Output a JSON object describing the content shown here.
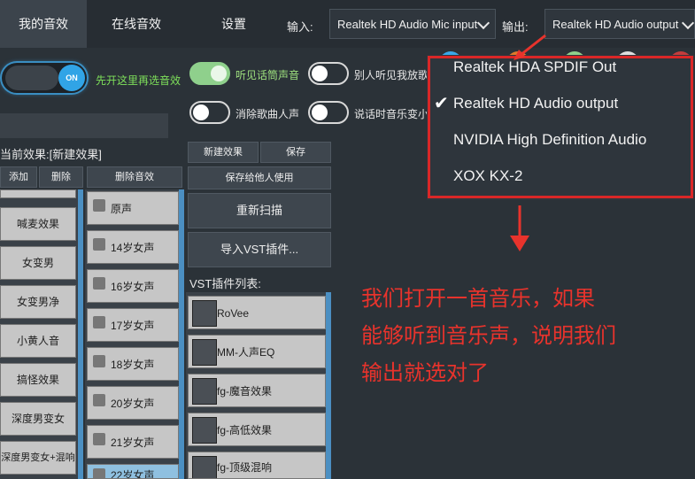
{
  "tabs": [
    "我的音效",
    "在线音效",
    "设置"
  ],
  "input_label": "输入:",
  "input_value": "Realtek HD Audio Mic input",
  "output_label": "输出:",
  "output_value": "Realtek HD Audio output",
  "main_switch_label": "ON",
  "main_switch_hint": "先开这里再选音效",
  "toggles": [
    "听见话筒声音",
    "别人听见我放歌",
    "消除歌曲人声",
    "说话时音乐变小"
  ],
  "current_effect": "当前效果:[新建效果]",
  "left_buttons": [
    "添加",
    "删除",
    "删除音效"
  ],
  "right_buttons": [
    "新建效果",
    "保存",
    "保存给他人使用",
    "重新扫描",
    "导入VST插件..."
  ],
  "effects_list": [
    "喊麦效果",
    "女变男",
    "女变男净",
    "小黄人音",
    "搞怪效果",
    "深度男变女",
    "深度男变女+混响"
  ],
  "voice_list": [
    "原声",
    "14岁女声",
    "16岁女声",
    "17岁女声",
    "18岁女声",
    "20岁女声",
    "21岁女声",
    "22岁女声"
  ],
  "vst_header": "VST插件列表:",
  "vst_list": [
    "RoVee",
    "MM-人声EQ",
    "fg-魔音效果",
    "fg-高低效果",
    "fg-顶级混响"
  ],
  "dropdown_options": [
    "Realtek HDA SPDIF Out",
    "Realtek HD Audio output",
    "NVIDIA High Definition Audio",
    "XOX KX-2"
  ],
  "selected_option": "Realtek HD Audio output",
  "annotation": [
    "我们打开一首音乐，如果",
    "能够听到音乐声，说明我们",
    "输出就选对了"
  ],
  "colors": {
    "accent": "#31a4e6",
    "annotation_red": "#e8332c",
    "toggle_green": "#8fd08c"
  }
}
